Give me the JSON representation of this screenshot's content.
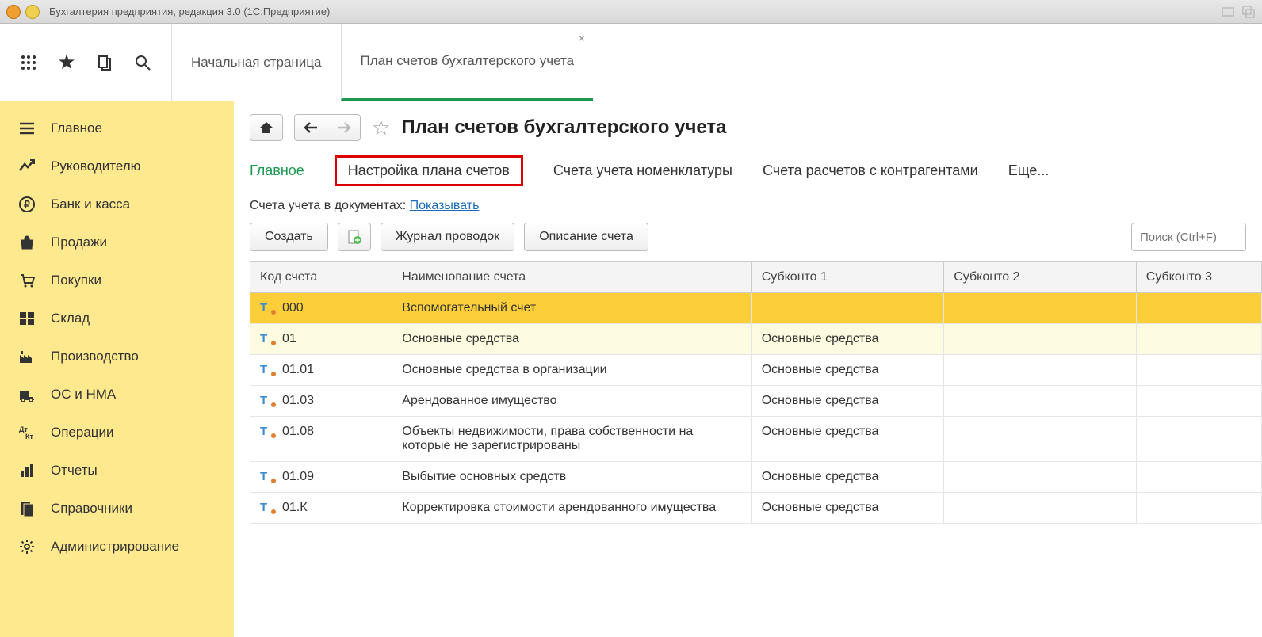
{
  "titlebar": {
    "text": "Бухгалтерия предприятия, редакция 3.0  (1С:Предприятие)"
  },
  "tabs": {
    "start": "Начальная страница",
    "active": "План счетов бухгалтерского учета"
  },
  "sidebar": {
    "items": [
      {
        "label": "Главное",
        "icon": "menu"
      },
      {
        "label": "Руководителю",
        "icon": "trend"
      },
      {
        "label": "Банк и касса",
        "icon": "ruble"
      },
      {
        "label": "Продажи",
        "icon": "bag"
      },
      {
        "label": "Покупки",
        "icon": "cart"
      },
      {
        "label": "Склад",
        "icon": "tiles"
      },
      {
        "label": "Производство",
        "icon": "factory"
      },
      {
        "label": "ОС и НМА",
        "icon": "truck"
      },
      {
        "label": "Операции",
        "icon": "ops"
      },
      {
        "label": "Отчеты",
        "icon": "bars"
      },
      {
        "label": "Справочники",
        "icon": "books"
      },
      {
        "label": "Администрирование",
        "icon": "gear"
      }
    ]
  },
  "page": {
    "title": "План счетов бухгалтерского учета",
    "subtabs": {
      "main": "Главное",
      "setup": "Настройка плана счетов",
      "nom": "Счета учета номенклатуры",
      "contr": "Счета расчетов с контрагентами",
      "more": "Еще..."
    },
    "info_prefix": "Счета учета в документах: ",
    "info_link": "Показывать",
    "actions": {
      "create": "Создать",
      "journal": "Журнал проводок",
      "desc": "Описание счета"
    },
    "search_placeholder": "Поиск (Ctrl+F)"
  },
  "grid": {
    "headers": {
      "code": "Код счета",
      "name": "Наименование счета",
      "sub1": "Субконто 1",
      "sub2": "Субконто 2",
      "sub3": "Субконто 3"
    },
    "rows": [
      {
        "code": "000",
        "name": "Вспомогательный счет",
        "sub1": "",
        "selected": true
      },
      {
        "code": "01",
        "name": "Основные средства",
        "sub1": "Основные средства",
        "alt": true
      },
      {
        "code": "01.01",
        "name": "Основные средства в организации",
        "sub1": "Основные средства"
      },
      {
        "code": "01.03",
        "name": "Арендованное имущество",
        "sub1": "Основные средства"
      },
      {
        "code": "01.08",
        "name": "Объекты недвижимости, права собственности на которые не зарегистрированы",
        "sub1": "Основные средства"
      },
      {
        "code": "01.09",
        "name": "Выбытие основных средств",
        "sub1": "Основные средства"
      },
      {
        "code": "01.К",
        "name": "Корректировка стоимости арендованного имущества",
        "sub1": "Основные средства"
      }
    ]
  }
}
